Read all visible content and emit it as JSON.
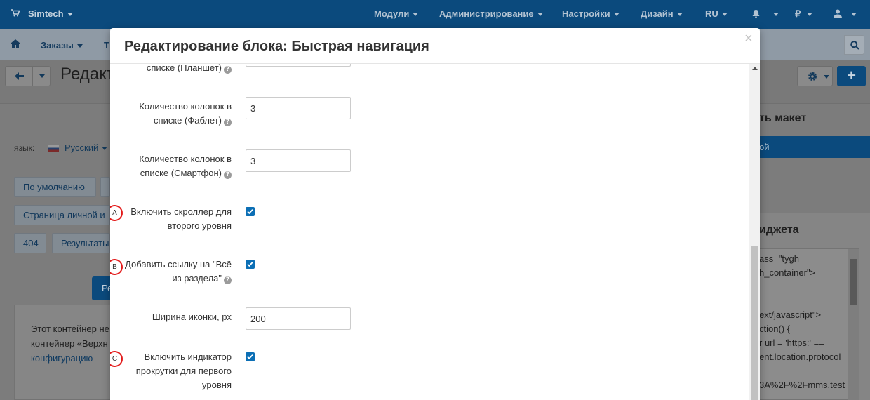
{
  "topbar": {
    "brand": "Simtech",
    "menus": [
      "Модули",
      "Администрирование",
      "Настройки",
      "Дизайн",
      "RU"
    ],
    "currency": "₽"
  },
  "navbar": {
    "orders": "Заказы",
    "truncated_item": "Т"
  },
  "page": {
    "title": "Редакт",
    "lang_label": "язык:",
    "lang_value": "Русский",
    "tags": [
      "По умолчанию",
      "Страница личной и",
      "404",
      "Результаты"
    ],
    "blue_button": "Ре",
    "note_lines": [
      "Этот контейнер не",
      "контейнер «Верхн"
    ],
    "note_link": "конфигурацию",
    "right_title": "ть макет",
    "right_blue": "ой",
    "right_card_title": "иджета",
    "code_lines": [
      "ass=\"tygh",
      "h_container\">",
      "",
      "",
      "ext/javascript\">",
      "ction() {",
      "r url = 'https:' ==",
      "ent.location.protocol",
      "",
      "3A%2F%2Fmms.test"
    ]
  },
  "modal": {
    "title": "Редактирование блока: Быстрая навигация",
    "close": "×",
    "fields": {
      "tablet_partial": "списке (Планшет)",
      "phablet_label_1": "Количество колонок в",
      "phablet_label_2": "списке (Фаблет)",
      "phablet_value": "3",
      "phone_label_1": "Количество колонок в",
      "phone_label_2": "списке (Смартфон)",
      "phone_value": "3",
      "scroller_label_1": "Включить скроллер для",
      "scroller_label_2": "второго уровня",
      "scroller_checked": true,
      "viewall_label_1": "Добавить ссылку на \"Всё",
      "viewall_label_2": "из раздела\"",
      "viewall_checked": true,
      "icon_width_label": "Ширина иконки, px",
      "icon_width_value": "200",
      "indicator_label_1": "Включить индикатор",
      "indicator_label_2": "прокрутки для первого",
      "indicator_label_3": "уровня",
      "indicator_checked": true
    },
    "markers": [
      "A",
      "B",
      "C"
    ]
  },
  "colors": {
    "topbar": "#0b4a7d",
    "checkbox": "#0c6fb5",
    "marker_ring": "#e31b1b"
  }
}
